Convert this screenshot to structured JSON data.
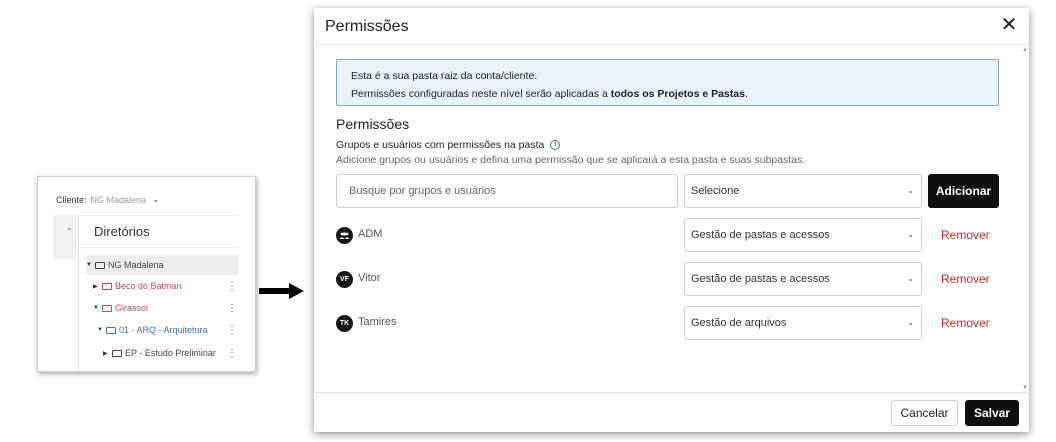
{
  "thumbnail": {
    "client_label": "Cliente:",
    "client_value": "NG Madalena",
    "directories_title": "Diretórios",
    "tree": [
      {
        "label": "NG Madalena",
        "color": "#444444"
      },
      {
        "label": "Beco do Batman",
        "color": "#c0495b"
      },
      {
        "label": "Girassol",
        "color": "#c0495b"
      },
      {
        "label": "01 - ARQ - Arquitetura",
        "color": "#3d6fc4"
      },
      {
        "label": "EP - Estudo Preliminar",
        "color": "#444444"
      }
    ]
  },
  "modal": {
    "title": "Permissões",
    "close_glyph": "✕",
    "info_line1": "Esta é a sua pasta raiz da conta/cliente.",
    "info_line2_prefix": "Permissões configuradas neste nível serão aplicadas a ",
    "info_line2_bold": "todos os Projetos e Pastas",
    "info_line2_suffix": ".",
    "section_title": "Permissões",
    "groups_label": "Grupos e usuários com permissões na pasta",
    "groups_description": "Adicione grupos ou usuários e defina uma permissão que se aplicará a esta pasta e suas subpastas.",
    "search_placeholder": "Busque por grupos e usuários",
    "permission_select_placeholder": "Selecione",
    "add_button": "Adicionar",
    "members": [
      {
        "initials": "",
        "name": "ADM",
        "permission": "Gestão de pastas e acessos",
        "remove": "Remover",
        "icon": "group-icon"
      },
      {
        "initials": "VF",
        "name": "Vitor",
        "permission": "Gestão de pastas e acessos",
        "remove": "Remover"
      },
      {
        "initials": "TK",
        "name": "Tamires",
        "permission": "Gestão de arquivos",
        "remove": "Remover"
      }
    ],
    "cancel_button": "Cancelar",
    "save_button": "Salvar"
  },
  "colors": {
    "primary": "#0f0f0f",
    "danger": "#c62828",
    "info_bg": "#eaf2fb",
    "info_border": "#7fa8d6"
  }
}
